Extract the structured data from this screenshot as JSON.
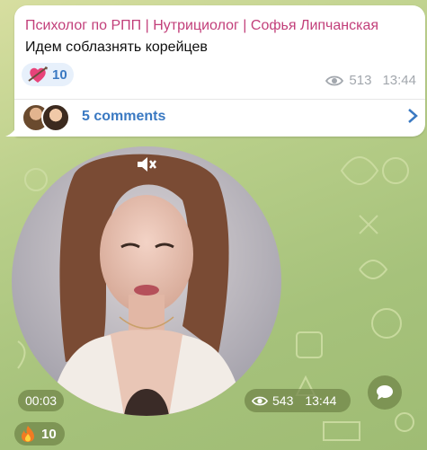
{
  "post": {
    "channel_name": "Психолог по РПП | Нутрициолог | Софья Липчанская",
    "message_text": "Идем соблазнять корейцев",
    "reaction": {
      "icon": "heart-arrow-icon",
      "count": "10"
    },
    "views": "513",
    "time": "13:44",
    "comments_label": "5 comments"
  },
  "video_message": {
    "duration": "00:03",
    "views": "543",
    "time": "13:44",
    "reaction": {
      "icon": "fire-icon",
      "count": "10"
    }
  },
  "colors": {
    "channel_name": "#c23f7a",
    "link": "#3a79c2",
    "background": "#b9cf8a",
    "overlay": "rgba(110,130,70,0.7)"
  }
}
